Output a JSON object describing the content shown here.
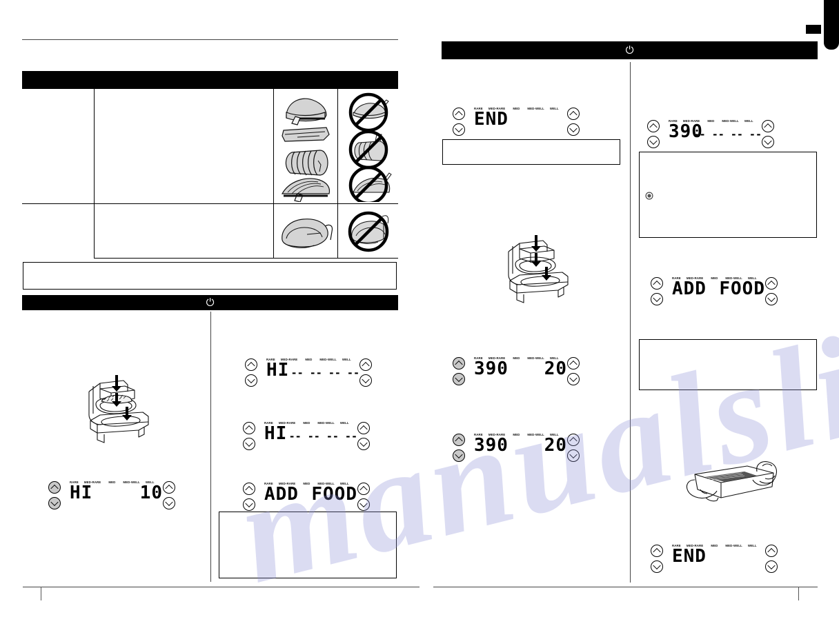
{
  "document": {
    "kind": "appliance-manual-spread",
    "pages": 2,
    "power_symbol": "⏻"
  },
  "doneness_labels": [
    "RARE",
    "MED-RARE",
    "MED",
    "MED-WELL",
    "WELL"
  ],
  "left_page": {
    "table": {
      "header_band": "",
      "rows": [
        {
          "label": "",
          "body": "",
          "ok_image": "meat-cuts-with-probe",
          "no_image": "meat-cuts-probe-prohibited"
        },
        {
          "label": "",
          "body": "",
          "ok_image": "whole-poultry-with-probe",
          "no_image": "whole-poultry-probe-prohibited"
        }
      ]
    },
    "note_box": "",
    "section_band": {
      "title": "",
      "icon": "power-icon"
    },
    "illustration": "grill-open-insert-basket-with-food",
    "panels": [
      {
        "id": "left-hi-10",
        "left_value": "HI",
        "right_value": "10",
        "dashes_left": "",
        "dashes_right": "",
        "arrows_left_shaded": true,
        "arrows_right_shaded": false
      },
      {
        "id": "right-hi-dashes-1",
        "left_value": "HI",
        "right_value": "",
        "dashes_left": "",
        "dashes_right": "-- -- -- --",
        "arrows_left_shaded": false,
        "arrows_right_shaded": false
      },
      {
        "id": "right-hi-dashes-2",
        "left_value": "HI",
        "right_value": "",
        "dashes_left": "",
        "dashes_right": "-- -- -- --",
        "arrows_left_shaded": false,
        "arrows_right_shaded": false
      },
      {
        "id": "right-add-food",
        "left_value": "ADD",
        "right_value": "FOOD",
        "dashes_left": "",
        "dashes_right": "",
        "arrows_left_shaded": false,
        "arrows_right_shaded": false
      }
    ],
    "bottom_note_box": ""
  },
  "right_page": {
    "section_band": {
      "title": "",
      "icon": "power-icon"
    },
    "panels": [
      {
        "id": "end-top",
        "left_value": "END",
        "right_value": "",
        "dashes_right": "",
        "arrows_left_shaded": false,
        "arrows_right_shaded": false
      },
      {
        "id": "390-dashes",
        "left_value": "390",
        "right_value": "",
        "dashes_right": "-- -- -- --",
        "arrows_left_shaded": false,
        "arrows_right_shaded": false
      },
      {
        "id": "390-20-a",
        "left_value": "390",
        "right_value": "20",
        "dashes_right": "",
        "arrows_left_shaded": true,
        "arrows_right_shaded": false
      },
      {
        "id": "390-20-b",
        "left_value": "390",
        "right_value": "20",
        "dashes_right": "",
        "arrows_left_shaded": true,
        "arrows_right_shaded": false
      },
      {
        "id": "add-food-right",
        "left_value": "ADD",
        "right_value": "FOOD",
        "dashes_right": "",
        "arrows_left_shaded": false,
        "arrows_right_shaded": false
      },
      {
        "id": "end-bottom",
        "left_value": "END",
        "right_value": "",
        "dashes_right": "",
        "arrows_left_shaded": false,
        "arrows_right_shaded": false
      }
    ],
    "note_boxes": [
      "",
      "",
      ""
    ],
    "bullet_icon": "note-bullet-icon",
    "illustrations": [
      "grill-open-insert-basket",
      "hands-holding-basket-with-food"
    ],
    "corner_tab": ""
  },
  "watermark": {
    "line1": "manualslive.com",
    "parts": [
      "m",
      "a",
      "n",
      "u",
      "a",
      "l",
      "s",
      "l",
      "i",
      "v",
      "e",
      ".",
      "c",
      "o",
      "m"
    ]
  }
}
